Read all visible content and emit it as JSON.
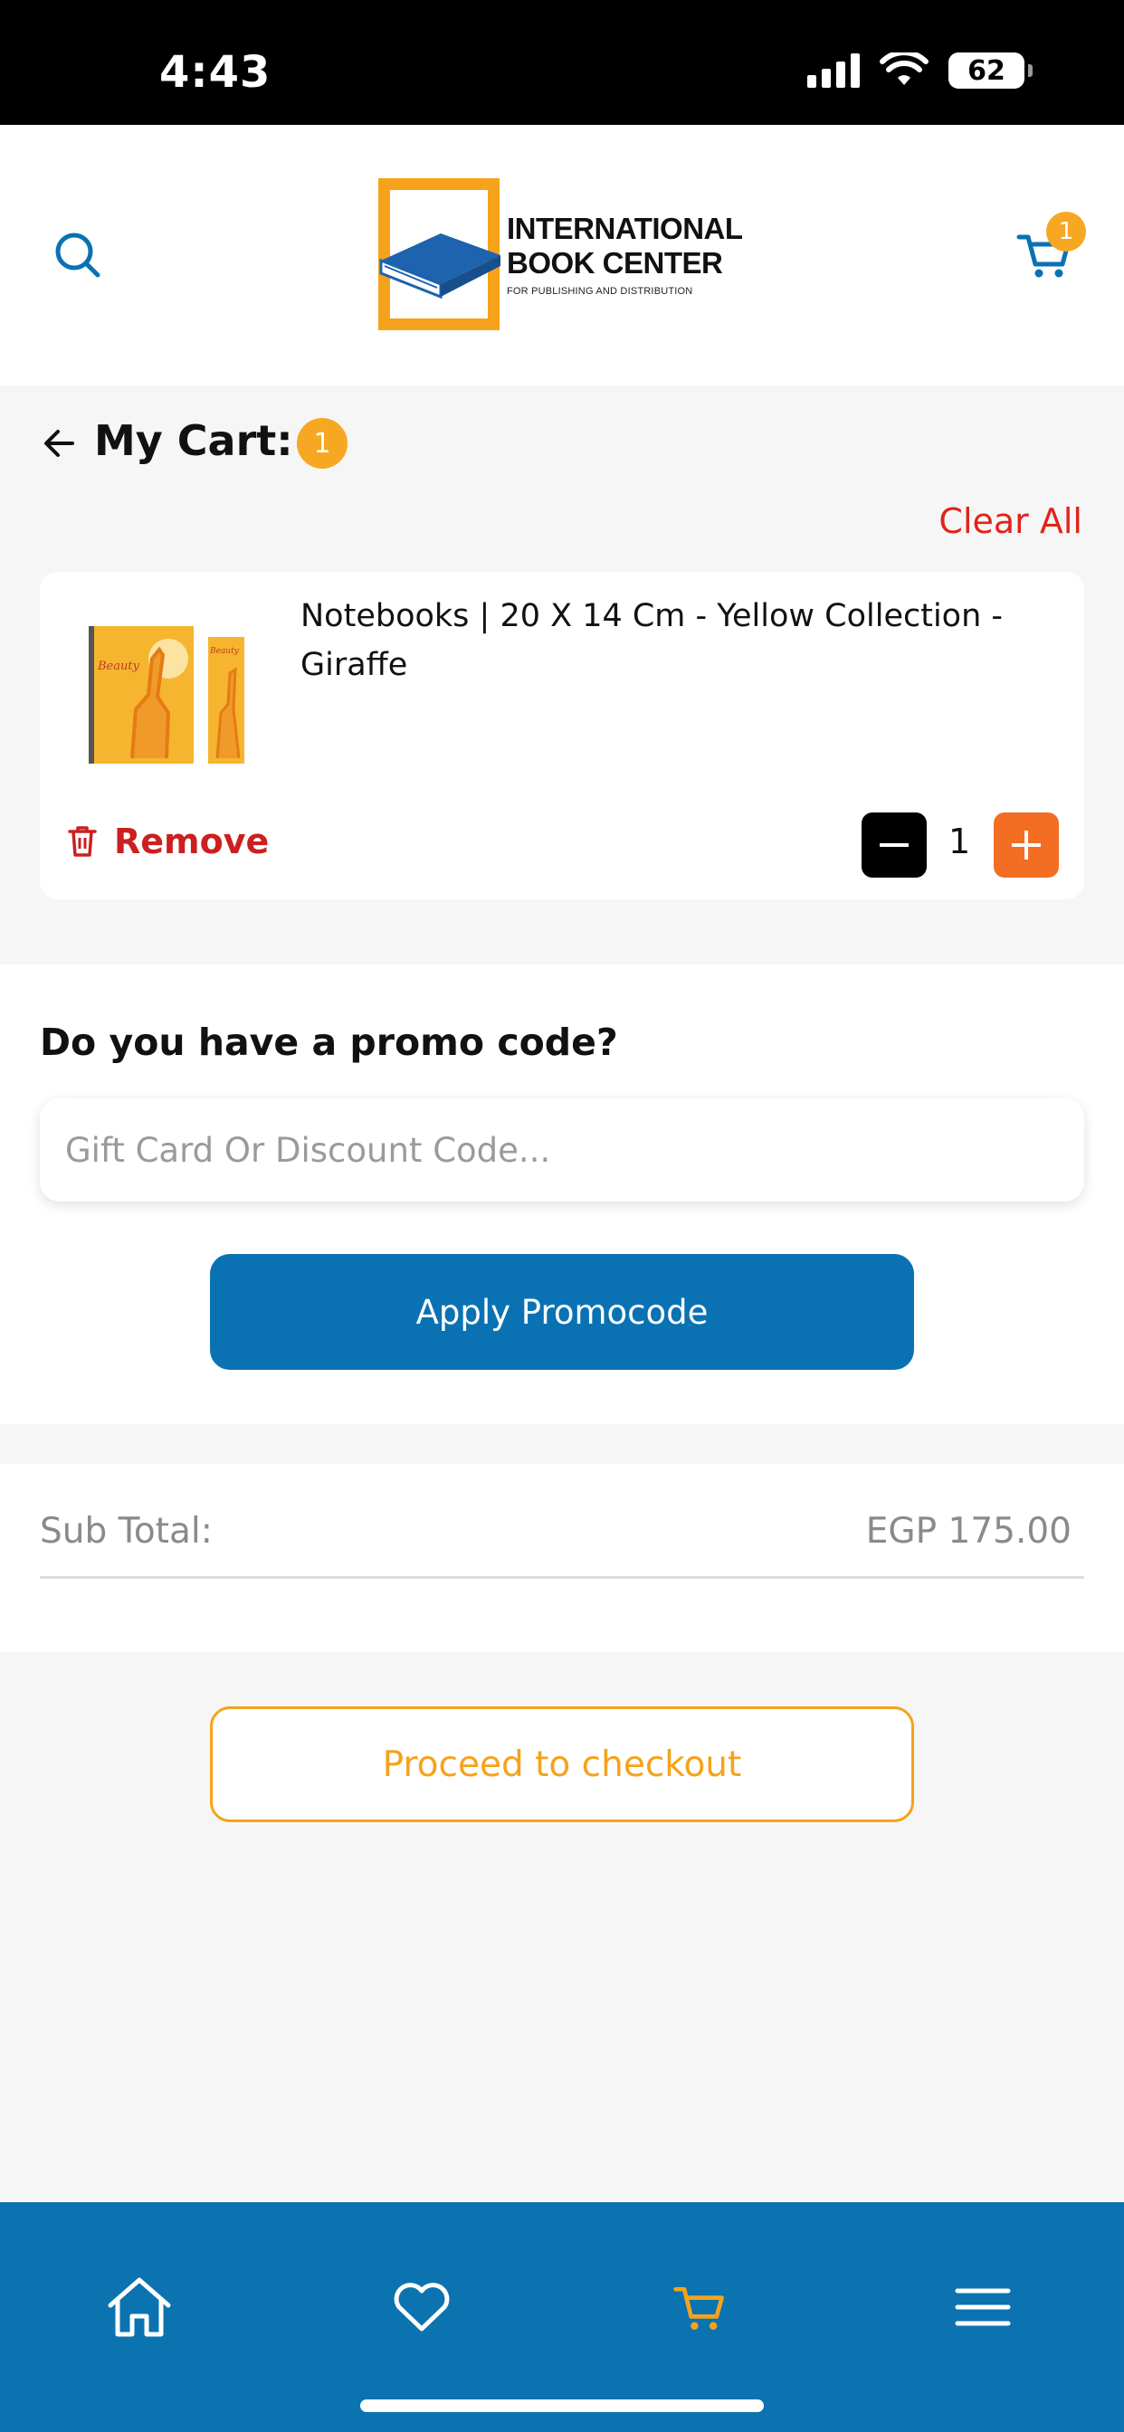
{
  "status_bar": {
    "time": "4:43",
    "battery": "62"
  },
  "header": {
    "logo": {
      "line1": "INTERNATIONAL",
      "line2": "BOOK CENTER",
      "tagline": "FOR PUBLISHING AND DISTRIBUTION"
    },
    "cart_badge": "1"
  },
  "page": {
    "title": "My Cart:",
    "count_badge": "1",
    "clear_all": "Clear All"
  },
  "cart": {
    "items": [
      {
        "name": "Notebooks | 20 X 14 Cm - Yellow Collection - Giraffe",
        "quantity": "1",
        "remove_label": "Remove"
      }
    ]
  },
  "promo": {
    "heading": "Do you have a promo code?",
    "placeholder": "Gift Card Or Discount Code...",
    "apply_label": "Apply Promocode"
  },
  "summary": {
    "subtotal_label": "Sub Total:",
    "subtotal_value": "EGP 175.00"
  },
  "checkout": {
    "label": "Proceed to checkout"
  },
  "bottom_nav": {
    "items": [
      {
        "icon": "home-icon",
        "active": false
      },
      {
        "icon": "heart-icon",
        "active": false
      },
      {
        "icon": "cart-icon",
        "active": true
      },
      {
        "icon": "menu-icon",
        "active": false
      }
    ]
  },
  "colors": {
    "primary": "#0a72b3",
    "accent": "#f6a21b",
    "danger": "#e0241b",
    "plus_button": "#f36d23",
    "background": "#f6f6f6"
  }
}
